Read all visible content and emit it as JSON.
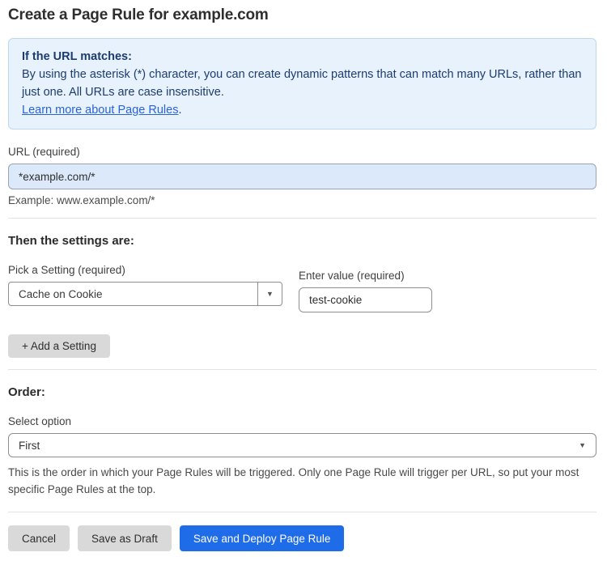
{
  "page": {
    "title": "Create a Page Rule for example.com"
  },
  "info_box": {
    "heading": "If the URL matches:",
    "body": "By using the asterisk (*) character, you can create dynamic patterns that can match many URLs, rather than just one. All URLs are case insensitive.",
    "link_label": "Learn more about Page Rules",
    "link_suffix": "."
  },
  "url_field": {
    "label": "URL (required)",
    "value": "*example.com/*",
    "helper": "Example: www.example.com/*"
  },
  "settings_section": {
    "heading": "Then the settings are:",
    "setting_select": {
      "label": "Pick a Setting (required)",
      "value": "Cache on Cookie"
    },
    "value_field": {
      "label": "Enter value (required)",
      "value": "test-cookie"
    },
    "add_setting_label": "+ Add a Setting"
  },
  "order_section": {
    "heading": "Order:",
    "select_label": "Select option",
    "selected_option": "First",
    "helper": "This is the order in which your Page Rules will be triggered. Only one Page Rule will trigger per URL, so put your most specific Page Rules at the top."
  },
  "footer": {
    "cancel_label": "Cancel",
    "save_draft_label": "Save as Draft",
    "save_deploy_label": "Save and Deploy Page Rule"
  },
  "icons": {
    "dropdown_caret": "▼"
  },
  "colors": {
    "accent_blue": "#1f6ce8",
    "info_background": "#e8f2fc",
    "info_border": "#bcd7f2",
    "info_text": "#1d3c6e",
    "link_blue": "#2b62d9",
    "url_input_background": "#dbe9fa",
    "button_gray": "#d9d9d9"
  }
}
